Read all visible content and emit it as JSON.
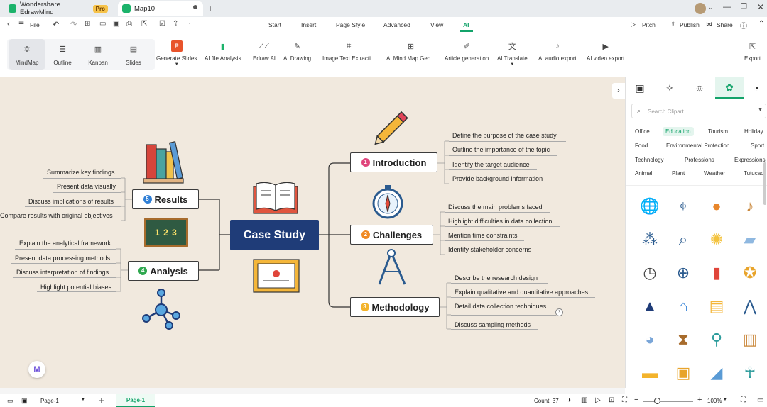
{
  "titlebar": {
    "app_name": "Wondershare EdrawMind",
    "pro_badge": "Pro",
    "doc_tab": "Map10"
  },
  "menubar": {
    "file": "File",
    "items": [
      "Start",
      "Insert",
      "Page Style",
      "Advanced",
      "View",
      "AI"
    ],
    "pitch": "Pitch",
    "publish": "Publish",
    "share": "Share"
  },
  "toolbar": {
    "views": [
      "MindMap",
      "Outline",
      "Kanban",
      "Slides"
    ],
    "tools": [
      "Generate Slides",
      "AI file Analysis",
      "Edraw AI",
      "AI Drawing",
      "Image Text Extracti...",
      "AI Mind Map Gen...",
      "Article generation",
      "AI Translate",
      "AI audio export",
      "AI video export"
    ],
    "export": "Export"
  },
  "mindmap": {
    "central": "Case Study",
    "topics": [
      {
        "num": "1",
        "label": "Introduction",
        "color": "#e0457b",
        "leaves": [
          "Define the purpose of the case study",
          "Outline the importance of the topic",
          "Identify the target audience",
          "Provide background information"
        ]
      },
      {
        "num": "2",
        "label": "Challenges",
        "color": "#f08a24",
        "leaves": [
          "Discuss the main problems faced",
          "Highlight difficulties in data collection",
          "Mention time constraints",
          "Identify stakeholder concerns"
        ]
      },
      {
        "num": "3",
        "label": "Methodology",
        "color": "#f3b32b",
        "leaves": [
          "Describe the research design",
          "Explain qualitative and quantitative approaches",
          "Detail data collection techniques",
          "Discuss sampling methods"
        ],
        "collapsed_count": "3"
      },
      {
        "num": "4",
        "label": "Analysis",
        "color": "#2fa84f",
        "leaves": [
          "Explain the analytical framework",
          "Present data processing methods",
          "Discuss interpretation of findings",
          "Highlight potential biases"
        ]
      },
      {
        "num": "5",
        "label": "Results",
        "color": "#2f7fd6",
        "leaves": [
          "Summarize key findings",
          "Present data visually",
          "Discuss implications of results",
          "Compare results with original objectives"
        ]
      }
    ],
    "board_digits": "1 2 3"
  },
  "panel": {
    "search_placeholder": "Search Clipart",
    "categories": [
      "Office",
      "Education",
      "Tourism",
      "Holiday",
      "Food",
      "Environmental Protection",
      "Sport",
      "Technology",
      "Professions",
      "Expressions",
      "Animal",
      "Plant",
      "Weather",
      "Tutucao"
    ],
    "active_category": "Education",
    "cliparts": [
      "globe-icon",
      "telescope-icon",
      "basketball-icon",
      "guitar-icon",
      "molecule-icon",
      "magnifier-icon",
      "lightbulb-icon",
      "eraser-icon",
      "stopwatch-icon",
      "compass-icon",
      "pencil-cup-icon",
      "medal-icon",
      "graduation-cap-icon",
      "school-icon",
      "certificate-icon",
      "drafting-compass-icon",
      "palette-icon",
      "hourglass-icon",
      "microscope-icon",
      "bookshelf-icon",
      "school-bus-icon",
      "notebook-icon",
      "utility-knife-icon",
      "figure-icon"
    ]
  },
  "statusbar": {
    "page_selector": "Page-1",
    "page_tab": "Page-1",
    "count": "Count: 37",
    "zoom": "100%"
  }
}
